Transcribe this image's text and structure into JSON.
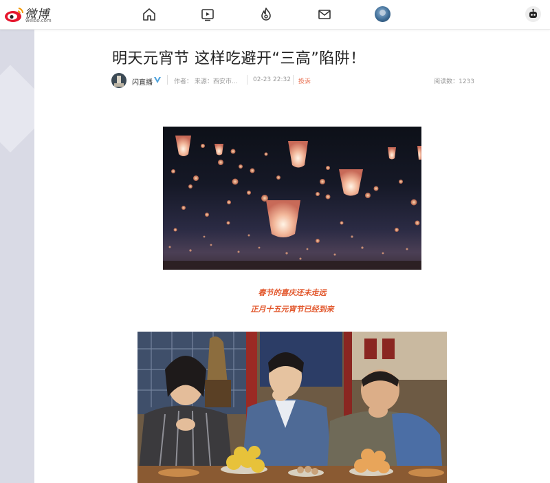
{
  "header": {
    "logo_cn": "微博",
    "logo_en": "weibo.com",
    "nav": [
      {
        "name": "home-icon"
      },
      {
        "name": "video-icon"
      },
      {
        "name": "hot-flame-icon"
      },
      {
        "name": "mail-icon"
      },
      {
        "name": "user-avatar"
      },
      {
        "name": "robot-icon"
      }
    ]
  },
  "article": {
    "title": "明天元宵节 这样吃避开“三高”陷阱！",
    "author": "闪直播",
    "source": "作者： 来源：西安市...",
    "time": "02-23 22:32",
    "complain": "投诉",
    "reads": "阅读数：1233",
    "captions": [
      "春节的喜庆还未走远",
      "正月十五元宵节已经到来"
    ]
  },
  "colors": {
    "accent": "#e2572c",
    "verified": "#4fa3dd",
    "sidebar": "#d9dae5"
  }
}
